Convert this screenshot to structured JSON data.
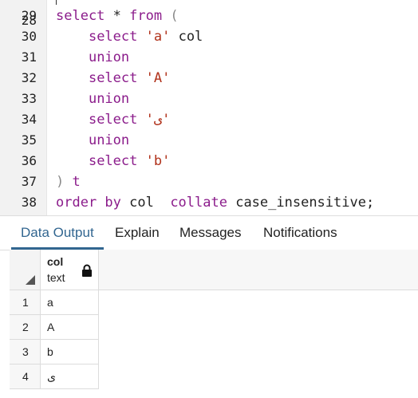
{
  "editor": {
    "lines": [
      {
        "num": "29",
        "tokens": [
          {
            "t": "select",
            "c": "kw"
          },
          {
            "t": " * ",
            "c": "plain"
          },
          {
            "t": "from",
            "c": "kw"
          },
          {
            "t": " (",
            "c": "punc"
          }
        ]
      },
      {
        "num": "30",
        "tokens": [
          {
            "t": "    ",
            "c": "plain"
          },
          {
            "t": "select",
            "c": "kw"
          },
          {
            "t": " ",
            "c": "plain"
          },
          {
            "t": "'a'",
            "c": "str"
          },
          {
            "t": " col",
            "c": "plain"
          }
        ]
      },
      {
        "num": "31",
        "tokens": [
          {
            "t": "    ",
            "c": "plain"
          },
          {
            "t": "union",
            "c": "kw"
          }
        ]
      },
      {
        "num": "32",
        "tokens": [
          {
            "t": "    ",
            "c": "plain"
          },
          {
            "t": "select",
            "c": "kw"
          },
          {
            "t": " ",
            "c": "plain"
          },
          {
            "t": "'A'",
            "c": "str"
          }
        ]
      },
      {
        "num": "33",
        "tokens": [
          {
            "t": "    ",
            "c": "plain"
          },
          {
            "t": "union",
            "c": "kw"
          }
        ]
      },
      {
        "num": "34",
        "tokens": [
          {
            "t": "    ",
            "c": "plain"
          },
          {
            "t": "select",
            "c": "kw"
          },
          {
            "t": " ",
            "c": "plain"
          },
          {
            "t": "'ی'",
            "c": "str"
          }
        ]
      },
      {
        "num": "35",
        "tokens": [
          {
            "t": "    ",
            "c": "plain"
          },
          {
            "t": "union",
            "c": "kw"
          }
        ]
      },
      {
        "num": "36",
        "tokens": [
          {
            "t": "    ",
            "c": "plain"
          },
          {
            "t": "select",
            "c": "kw"
          },
          {
            "t": " ",
            "c": "plain"
          },
          {
            "t": "'b'",
            "c": "str"
          }
        ]
      },
      {
        "num": "37",
        "tokens": [
          {
            "t": ")",
            "c": "punc"
          },
          {
            "t": " t",
            "c": "kw"
          }
        ]
      },
      {
        "num": "38",
        "tokens": [
          {
            "t": "order by",
            "c": "kw"
          },
          {
            "t": " col  ",
            "c": "plain"
          },
          {
            "t": "collate",
            "c": "kw"
          },
          {
            "t": " case_insensitive;",
            "c": "plain"
          }
        ]
      }
    ],
    "partial_top_line": "28"
  },
  "tabs": [
    {
      "label": "Data Output",
      "active": true
    },
    {
      "label": "Explain",
      "active": false
    },
    {
      "label": "Messages",
      "active": false
    },
    {
      "label": "Notifications",
      "active": false
    }
  ],
  "grid": {
    "column": {
      "name": "col",
      "type": "text",
      "icon": "lock-icon"
    },
    "rows": [
      {
        "num": "1",
        "value": "a"
      },
      {
        "num": "2",
        "value": "A"
      },
      {
        "num": "3",
        "value": "b"
      },
      {
        "num": "4",
        "value": "ی"
      }
    ]
  },
  "colors": {
    "keyword": "#8b1c8b",
    "string": "#b0311a",
    "active_tab": "#326690"
  }
}
